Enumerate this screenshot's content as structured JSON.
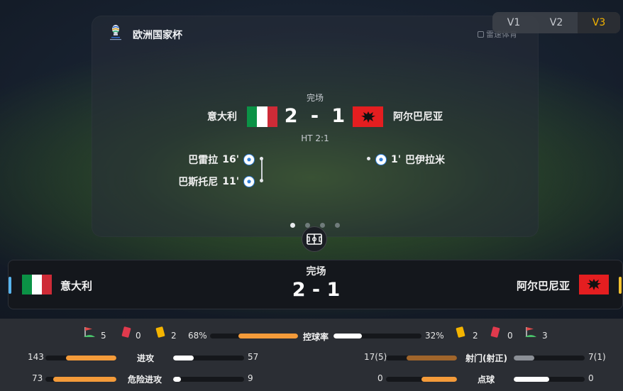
{
  "competition": {
    "name": "欧洲国家杯",
    "watermark": "雷速体育"
  },
  "version_switch": {
    "tabs": [
      "V1",
      "V2",
      "V3"
    ],
    "active": "V3",
    "active_color": "#f5b400"
  },
  "scoreboard": {
    "status": "完场",
    "home_team": "意大利",
    "away_team": "阿尔巴尼亚",
    "home_score": "2",
    "away_score": "1",
    "separator": "-",
    "half_time": "HT 2:1",
    "home_goals": [
      {
        "player": "巴雷拉",
        "minute": "16'"
      },
      {
        "player": "巴斯托尼",
        "minute": "11'"
      }
    ],
    "away_goals": [
      {
        "player": "巴伊拉米",
        "minute": "1'"
      }
    ],
    "page_dots": 4,
    "active_dot": 1
  },
  "match_bar": {
    "status": "完场",
    "score": "2 - 1",
    "home_team": "意大利",
    "away_team": "阿尔巴尼亚",
    "home_accent": "#58b4ee",
    "away_accent": "#f3c230"
  },
  "stats": {
    "home_counts": {
      "corners": "5",
      "red_cards": "0",
      "yellow_cards": "2"
    },
    "away_counts": {
      "yellow_cards": "2",
      "red_cards": "0",
      "corners": "3"
    },
    "possession": {
      "label": "控球率",
      "home": "68%",
      "away": "32%",
      "home_value": 68,
      "away_value": 32
    },
    "attacks": {
      "label": "进攻",
      "home": "143",
      "away": "57",
      "home_value": 143,
      "away_value": 57
    },
    "dangerous_attacks": {
      "label": "危险进攻",
      "home": "73",
      "away": "9",
      "home_value": 73,
      "away_value": 9
    },
    "shots": {
      "label": "射门(射正)",
      "home": "17(5)",
      "away": "7(1)",
      "home_value": 17,
      "away_value": 7
    },
    "penalties": {
      "label": "点球",
      "home": "0",
      "away": "0",
      "home_value": 0,
      "away_value": 0
    }
  }
}
